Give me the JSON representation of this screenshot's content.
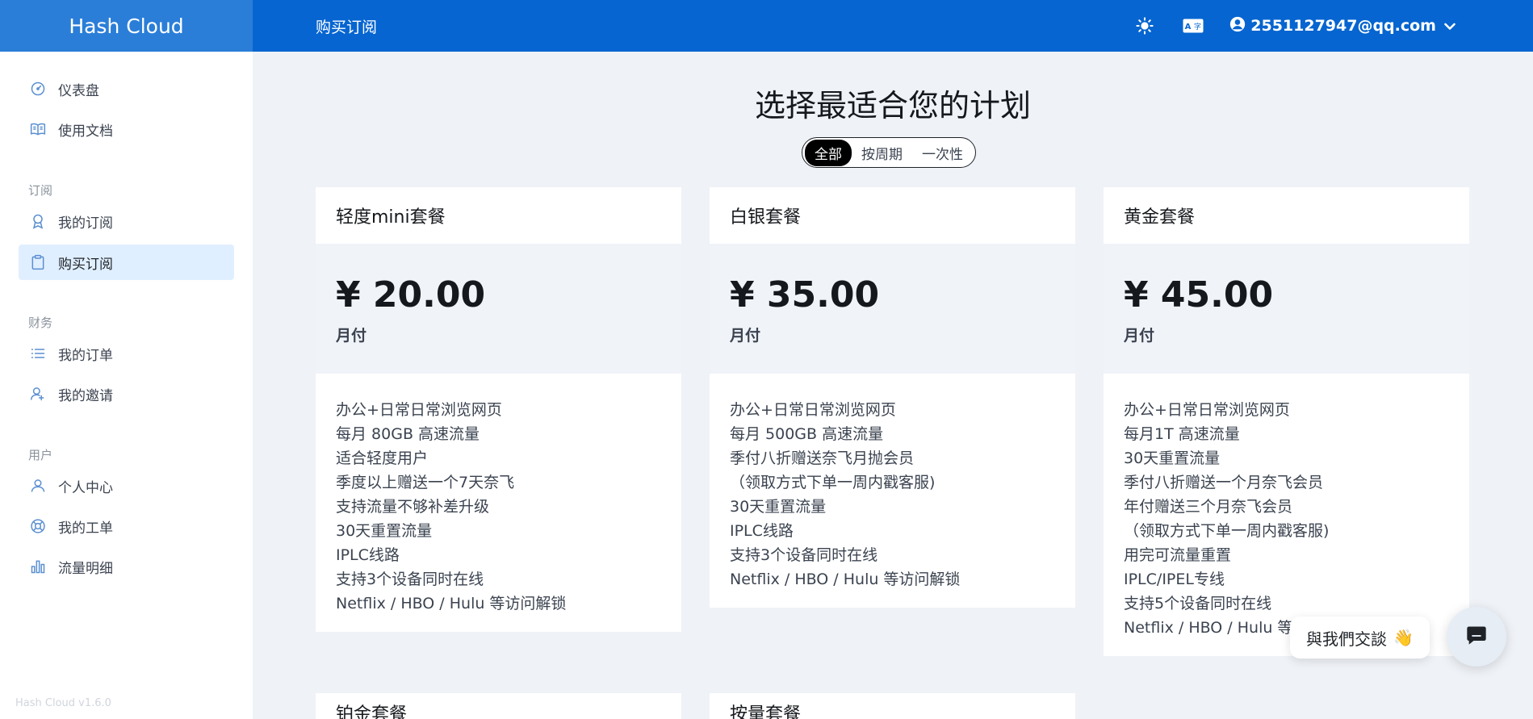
{
  "brand": {
    "name": "Hash Cloud",
    "version": "Hash Cloud v1.6.0"
  },
  "header": {
    "title": "购买订阅",
    "user_email": "2551127947@qq.com",
    "icons": [
      "sun-icon",
      "translate-icon",
      "user-circle-icon",
      "chevron-down-icon"
    ]
  },
  "sidebar": {
    "items": [
      {
        "label": "仪表盘",
        "icon": "dashboard-icon"
      },
      {
        "label": "使用文档",
        "icon": "book-icon"
      }
    ],
    "sections": [
      {
        "title": "订阅",
        "items": [
          {
            "label": "我的订阅",
            "icon": "badge-icon"
          },
          {
            "label": "购买订阅",
            "icon": "clipboard-icon",
            "active": true
          }
        ]
      },
      {
        "title": "财务",
        "items": [
          {
            "label": "我的订单",
            "icon": "list-icon"
          },
          {
            "label": "我的邀请",
            "icon": "user-invite-icon"
          }
        ]
      },
      {
        "title": "用户",
        "items": [
          {
            "label": "个人中心",
            "icon": "user-icon"
          },
          {
            "label": "我的工单",
            "icon": "support-icon"
          },
          {
            "label": "流量明细",
            "icon": "bar-chart-icon"
          }
        ]
      }
    ]
  },
  "main": {
    "title": "选择最适合您的计划",
    "filters": [
      "全部",
      "按周期",
      "一次性"
    ],
    "selected_filter": "全部",
    "plans": [
      {
        "name": "轻度mini套餐",
        "price": "¥ 20.00",
        "period": "月付",
        "features": [
          "办公+日常日常浏览网页",
          "每月 80GB 高速流量",
          "适合轻度用户",
          "季度以上赠送一个7天奈飞",
          "支持流量不够补差升级",
          "30天重置流量",
          "IPLC线路",
          "支持3个设备同时在线",
          "Netflix / HBO / Hulu 等访问解锁"
        ]
      },
      {
        "name": "白银套餐",
        "price": "¥ 35.00",
        "period": "月付",
        "features": [
          "办公+日常日常浏览网页",
          "每月 500GB 高速流量",
          "季付八折赠送奈飞月抛会员",
          "（领取方式下单一周内戳客服)",
          "30天重置流量",
          "IPLC线路",
          "支持3个设备同时在线",
          "Netflix / HBO / Hulu 等访问解锁"
        ]
      },
      {
        "name": "黄金套餐",
        "price": "¥ 45.00",
        "period": "月付",
        "features": [
          "办公+日常日常浏览网页",
          "每月1T 高速流量",
          "30天重置流量",
          "季付八折赠送一个月奈飞会员",
          "年付赠送三个月奈飞会员",
          "（领取方式下单一周内戳客服)",
          "用完可流量重置",
          "IPLC/IPEL专线",
          "支持5个设备同时在线",
          "Netflix / HBO / Hulu 等"
        ]
      }
    ],
    "more_plans": [
      "铂金套餐",
      "按量套餐"
    ]
  },
  "chat": {
    "label": "與我們交談",
    "emoji": "👋"
  },
  "colors": {
    "header": "#0665d0",
    "brand_bg": "#2a7ed8",
    "active_bg": "#e0efff",
    "page_bg": "#eff2f7"
  }
}
